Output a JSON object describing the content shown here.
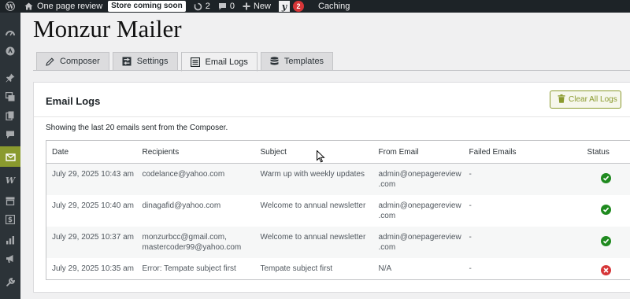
{
  "adminbar": {
    "site_name": "One page review",
    "coming_soon": "Store coming soon",
    "updates_count": "2",
    "comments_count": "0",
    "new_label": "New",
    "yoast_count": "2",
    "caching_label": "Caching"
  },
  "plugin_title": "Monzur Mailer",
  "tabs": [
    {
      "label": "Composer",
      "icon": "pencil-icon"
    },
    {
      "label": "Settings",
      "icon": "settings-icon"
    },
    {
      "label": "Email Logs",
      "icon": "list-icon",
      "active": true
    },
    {
      "label": "Templates",
      "icon": "database-icon"
    }
  ],
  "panel": {
    "title": "Email Logs",
    "clear_button": "Clear All Logs",
    "description": "Showing the last 20 emails sent from the Composer."
  },
  "table": {
    "headers": [
      "Date",
      "Recipients",
      "Subject",
      "From Email",
      "Failed Emails",
      "Status"
    ],
    "rows": [
      {
        "date": "July 29, 2025 10:43 am",
        "recipients_1": "codelance@yahoo.com",
        "recipients_2": "",
        "subject": "Warm up with weekly updates",
        "from_1": "admin@onepagereview",
        "from_2": ".com",
        "failed": "-",
        "status": "success"
      },
      {
        "date": "July 29, 2025 10:40 am",
        "recipients_1": "dinagafid@yahoo.com",
        "recipients_2": "",
        "subject": "Welcome to annual newsletter",
        "from_1": "admin@onepagereview",
        "from_2": ".com",
        "failed": "-",
        "status": "success"
      },
      {
        "date": "July 29, 2025 10:37 am",
        "recipients_1": "monzurbcc@gmail.com,",
        "recipients_2": "mastercoder99@yahoo.com",
        "subject": "Welcome to annual newsletter",
        "from_1": "admin@onepagereview",
        "from_2": ".com",
        "failed": "-",
        "status": "success"
      },
      {
        "date": "July 29, 2025 10:35 am",
        "recipients_1": "Error: Tempate subject first",
        "recipients_2": "",
        "subject": "Tempate subject first",
        "from_1": "N/A",
        "from_2": "",
        "failed": "-",
        "status": "error"
      }
    ]
  },
  "colors": {
    "accent": "#8a9a2e",
    "success": "#1f8a1f",
    "error": "#d63638",
    "adminbar": "#1d2327",
    "menu": "#2c3338"
  }
}
